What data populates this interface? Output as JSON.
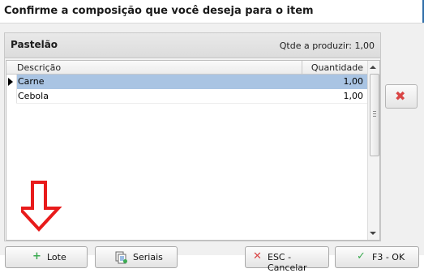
{
  "window": {
    "title": "Confirme a composição que você deseja para o item"
  },
  "panel": {
    "item_name": "Pastelão",
    "qty_to_produce": "Qtde a produzir: 1,00"
  },
  "grid": {
    "columns": [
      "Descrição",
      "Quantidade"
    ],
    "rows": [
      {
        "descricao": "Carne",
        "quantidade": "1,00",
        "selected": true
      },
      {
        "descricao": "Cebola",
        "quantidade": "1,00",
        "selected": false
      }
    ]
  },
  "buttons": {
    "lote": "Lote",
    "seriais": "Seriais",
    "cancel": "ESC - Cancelar",
    "ok": "F3 - OK"
  },
  "icons": {
    "remove": "close-icon",
    "lote": "plus-icon",
    "seriais": "serial-list-icon",
    "cancel": "close-icon",
    "ok": "check-icon"
  },
  "colors": {
    "selection": "#a9c4e3",
    "danger": "#d94545",
    "ok": "#3cab52",
    "annotation_arrow": "#e81b1b"
  }
}
